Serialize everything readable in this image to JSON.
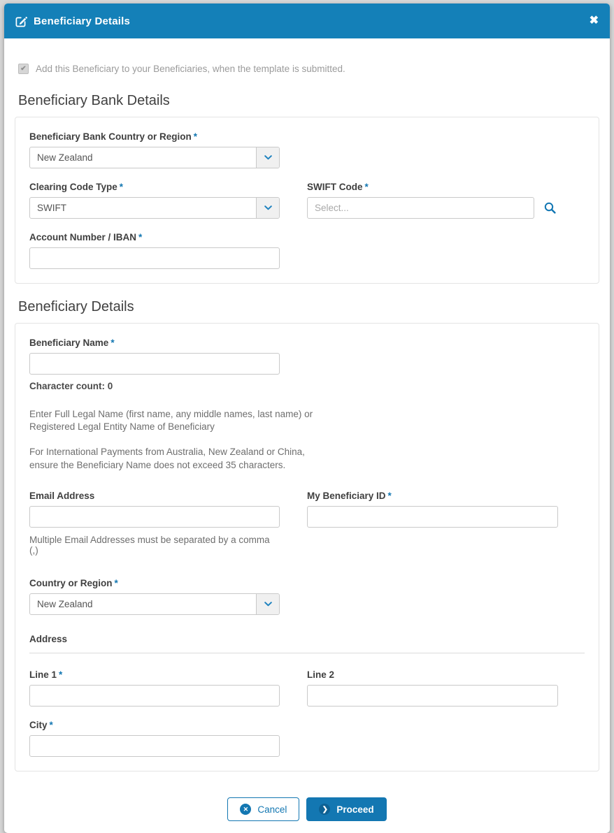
{
  "header": {
    "title": "Beneficiary Details"
  },
  "icons": {
    "edit": "pencil-square",
    "close": "✖",
    "search": "magnifier",
    "chevron_down": "chevron-down",
    "checkbox_check": "✔",
    "cancel_circle": "✕",
    "proceed_circle": "❯"
  },
  "required_marker": "*",
  "checkbox_note": "Add this Beneficiary to your Beneficiaries, when the template is submitted.",
  "bank_section": {
    "heading": "Beneficiary Bank Details",
    "country_label": "Beneficiary Bank Country or Region",
    "country_value": "New Zealand",
    "clearing_label": "Clearing Code Type",
    "clearing_value": "SWIFT",
    "swift_label": "SWIFT Code",
    "swift_placeholder": "Select...",
    "account_label": "Account Number / IBAN"
  },
  "beneficiary_section": {
    "heading": "Beneficiary Details",
    "name_label": "Beneficiary Name",
    "char_count": "Character count: 0",
    "help1": "Enter Full Legal Name (first name, any middle names, last name) or Registered Legal Entity Name of Beneficiary",
    "help2": "For International Payments from Australia, New Zealand or China, ensure the Beneficiary Name does not exceed 35 characters.",
    "email_label": "Email Address",
    "beneficiary_id_label": "My Beneficiary ID",
    "email_note": "Multiple Email Addresses must be separated by a comma (,)",
    "country_label": "Country or Region",
    "country_value": "New Zealand",
    "address_heading": "Address",
    "line1_label": "Line 1",
    "line2_label": "Line 2",
    "city_label": "City"
  },
  "footer": {
    "cancel_label": "Cancel",
    "proceed_label": "Proceed"
  },
  "colors": {
    "header_blue": "#1480b8",
    "accent_blue": "#1377b2",
    "chevron_blue": "#1e82bf"
  }
}
